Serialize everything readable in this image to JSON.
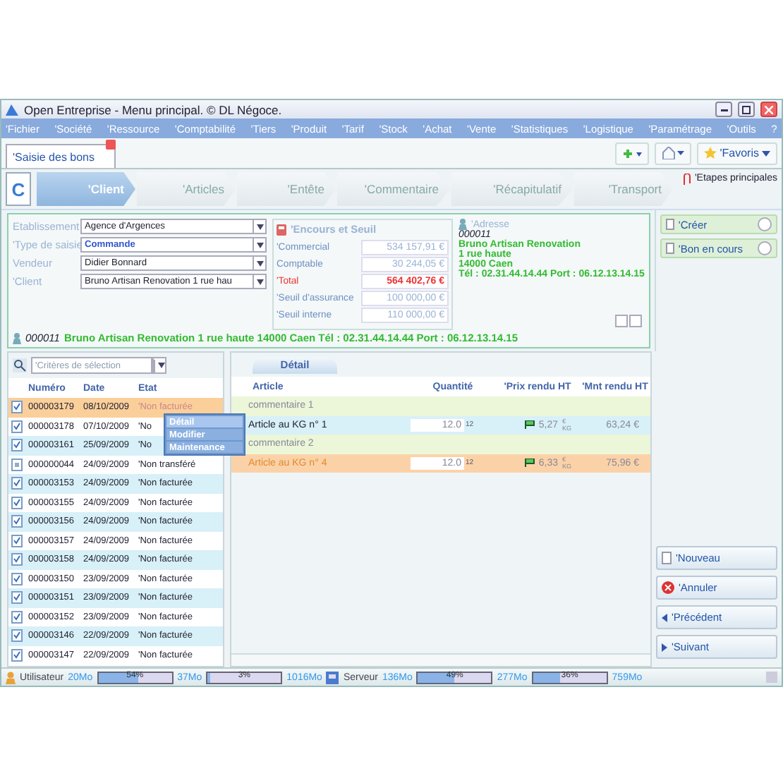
{
  "window": {
    "title": "Open Entreprise - Menu principal. © DL Négoce."
  },
  "menu": [
    "'Fichier",
    "'Société",
    "'Ressource",
    "'Comptabilité",
    "'Tiers",
    "'Produit",
    "'Tarif",
    "'Stock",
    "'Achat",
    "'Vente",
    "'Statistiques",
    "'Logistique",
    "'Paramétrage",
    "'Outils",
    "?"
  ],
  "tabs": [
    {
      "label": "'Saisie des bons",
      "selected": true
    }
  ],
  "toolbar": {
    "favorites": "'Favoris"
  },
  "steps": {
    "first": "C",
    "items": [
      {
        "label": "'Client",
        "selected": true
      },
      {
        "label": "'Articles",
        "selected": false
      },
      {
        "label": "'Entête",
        "selected": false
      },
      {
        "label": "'Commentaire",
        "selected": false
      },
      {
        "label": "'Récapitulatif",
        "selected": false
      },
      {
        "label": "'Transport",
        "selected": false
      }
    ],
    "main": "'Etapes principales"
  },
  "form": {
    "fields": [
      {
        "label": "Etablissement",
        "value": "Agence d'Argences",
        "emphasis": false
      },
      {
        "label": "'Type de saisie",
        "value": "Commande",
        "emphasis": true
      },
      {
        "label": "Vendeur",
        "value": "Didier Bonnard",
        "emphasis": false
      },
      {
        "label": "'Client",
        "value": "Bruno Artisan Renovation 1 rue hau",
        "emphasis": false
      }
    ],
    "outstanding": {
      "title": "'Encours et Seuil",
      "rows": [
        {
          "label": "'Commercial",
          "value": "534 157,91 €",
          "emphasis": false
        },
        {
          "label": "Comptable",
          "value": "30 244,05 €",
          "emphasis": false
        },
        {
          "label": "'Total",
          "value": "564 402,76 €",
          "emphasis": true
        },
        {
          "label": "'Seuil d'assurance",
          "value": "100 000,00 €",
          "emphasis": false
        },
        {
          "label": "'Seuil interne",
          "value": "110 000,00 €",
          "emphasis": false
        }
      ]
    },
    "address": {
      "title": "'Adresse",
      "code": "000011",
      "lines": [
        "Bruno Artisan Renovation",
        "1 rue haute",
        "14000 Caen",
        "Tél : 02.31.44.14.44 Port : 06.12.13.14.15"
      ]
    },
    "footer": {
      "code": "000011",
      "text": "Bruno Artisan Renovation 1 rue haute 14000 Caen Tél : 02.31.44.14.44 Port : 06.12.13.14.15"
    }
  },
  "side_panels": [
    {
      "label": "'Créer",
      "expanded": false
    },
    {
      "label": "'Bon en cours",
      "expanded": false
    }
  ],
  "list": {
    "filter": {
      "placeholder": "'Critères de sélection"
    },
    "columns": [
      "Numéro",
      "Date",
      "Etat"
    ],
    "rows": [
      {
        "kind": "check",
        "number": "000003179",
        "date": "08/10/2009",
        "state": "'Non facturée",
        "selected": true
      },
      {
        "kind": "check",
        "number": "000003178",
        "date": "07/10/2009",
        "state": "'No",
        "selected": false
      },
      {
        "kind": "check",
        "number": "000003161",
        "date": "25/09/2009",
        "state": "'No",
        "selected": false
      },
      {
        "kind": "box",
        "number": "000000044",
        "date": "24/09/2009",
        "state": "'Non transféré",
        "selected": false
      },
      {
        "kind": "check",
        "number": "000003153",
        "date": "24/09/2009",
        "state": "'Non facturée",
        "selected": false
      },
      {
        "kind": "check",
        "number": "000003155",
        "date": "24/09/2009",
        "state": "'Non facturée",
        "selected": false
      },
      {
        "kind": "check",
        "number": "000003156",
        "date": "24/09/2009",
        "state": "'Non facturée",
        "selected": false
      },
      {
        "kind": "check",
        "number": "000003157",
        "date": "24/09/2009",
        "state": "'Non facturée",
        "selected": false
      },
      {
        "kind": "check",
        "number": "000003158",
        "date": "24/09/2009",
        "state": "'Non facturée",
        "selected": false
      },
      {
        "kind": "check",
        "number": "000003150",
        "date": "23/09/2009",
        "state": "'Non facturée",
        "selected": false
      },
      {
        "kind": "check",
        "number": "000003151",
        "date": "23/09/2009",
        "state": "'Non facturée",
        "selected": false
      },
      {
        "kind": "check",
        "number": "000003152",
        "date": "23/09/2009",
        "state": "'Non facturée",
        "selected": false
      },
      {
        "kind": "check",
        "number": "000003146",
        "date": "22/09/2009",
        "state": "'Non facturée",
        "selected": false
      },
      {
        "kind": "check",
        "number": "000003147",
        "date": "22/09/2009",
        "state": "'Non facturée",
        "selected": false
      }
    ],
    "context_menu": [
      {
        "label": "Détail",
        "selected": true
      },
      {
        "label": "Modifier",
        "selected": false
      },
      {
        "label": "Maintenance",
        "selected": false
      }
    ]
  },
  "detail": {
    "tab": "Détail",
    "columns": [
      "Article",
      "Quantité",
      "'Prix rendu HT",
      "'Mnt rendu HT"
    ],
    "rows": [
      {
        "kind": "comment",
        "article": "commentaire 1",
        "selected": false
      },
      {
        "kind": "article",
        "article": "Article au KG n° 1",
        "quantity": "12.0",
        "quantity_unit": "12",
        "price": "5,27",
        "price_unit_top": "€",
        "price_unit_bottom": "KG",
        "amount": "63,24 €",
        "selected": false
      },
      {
        "kind": "comment",
        "article": "commentaire 2",
        "selected": false
      },
      {
        "kind": "article",
        "article": "Article au KG n° 4",
        "quantity": "12.0",
        "quantity_unit": "12",
        "price": "6,33",
        "price_unit_top": "€",
        "price_unit_bottom": "KG",
        "amount": "75,96 €",
        "selected": true
      }
    ]
  },
  "actions": [
    "'Nouveau",
    "'Annuler",
    "'Précédent",
    "'Suivant"
  ],
  "status_bar": {
    "groups": [
      {
        "kind": "user",
        "label": "Utilisateur",
        "a": "20Mo",
        "m1": {
          "text": "54%",
          "level": 0.54
        },
        "b": "37Mo",
        "m2": {
          "text": "3%",
          "level": 0.03
        },
        "c": "1016Mo"
      },
      {
        "kind": "server",
        "label": "Serveur",
        "a": "136Mo",
        "m1": {
          "text": "49%",
          "level": 0.49
        },
        "b": "277Mo",
        "m2": {
          "text": "36%",
          "level": 0.36
        },
        "c": "759Mo"
      }
    ]
  }
}
